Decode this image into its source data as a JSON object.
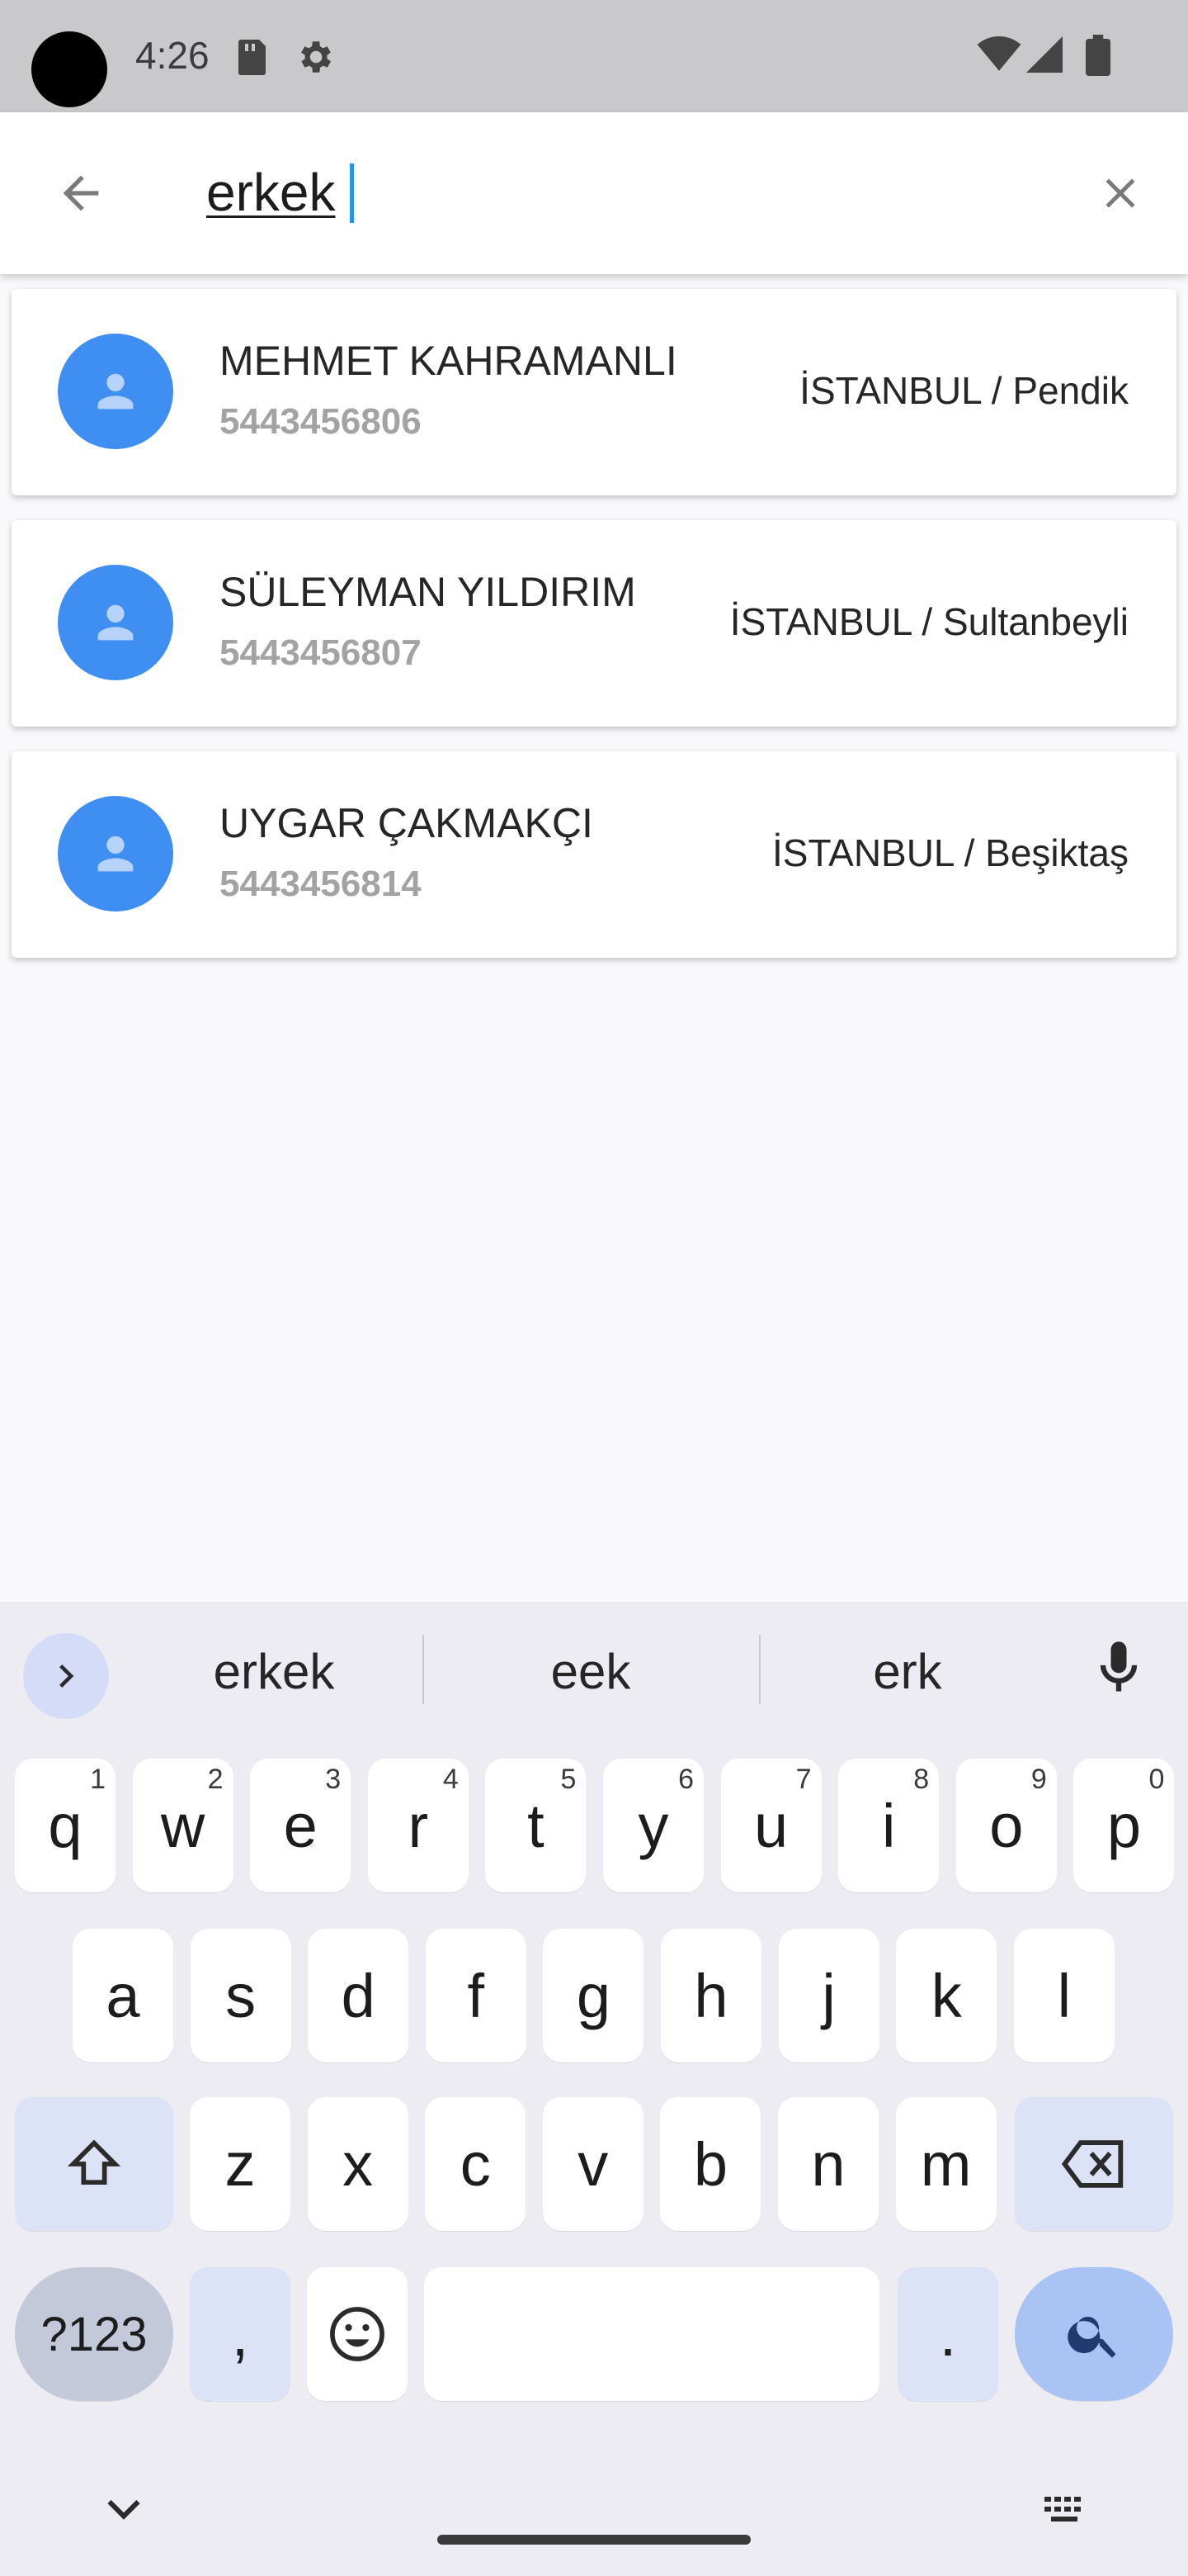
{
  "status_bar": {
    "time": "4:26"
  },
  "search": {
    "value": "erkek",
    "placeholder": ""
  },
  "results": [
    {
      "name": "MEHMET KAHRAMANLI",
      "phone": "5443456806",
      "location": "İSTANBUL / Pendik"
    },
    {
      "name": "SÜLEYMAN YILDIRIM",
      "phone": "5443456807",
      "location": "İSTANBUL / Sultanbeyli"
    },
    {
      "name": "UYGAR ÇAKMAKÇI",
      "phone": "5443456814",
      "location": "İSTANBUL / Beşiktaş"
    }
  ],
  "keyboard": {
    "suggestions": [
      "erkek",
      "eek",
      "erk"
    ],
    "row1": [
      {
        "l": "q",
        "n": "1"
      },
      {
        "l": "w",
        "n": "2"
      },
      {
        "l": "e",
        "n": "3"
      },
      {
        "l": "r",
        "n": "4"
      },
      {
        "l": "t",
        "n": "5"
      },
      {
        "l": "y",
        "n": "6"
      },
      {
        "l": "u",
        "n": "7"
      },
      {
        "l": "i",
        "n": "8"
      },
      {
        "l": "o",
        "n": "9"
      },
      {
        "l": "p",
        "n": "0"
      }
    ],
    "row2": [
      "a",
      "s",
      "d",
      "f",
      "g",
      "h",
      "j",
      "k",
      "l"
    ],
    "row3": [
      "z",
      "x",
      "c",
      "v",
      "b",
      "n",
      "m"
    ],
    "symbols_label": "?123",
    "comma_label": ",",
    "period_label": "."
  },
  "colors": {
    "accent": "#2196f3",
    "avatar": "#3f8ff3",
    "keyboard_bg": "#eeecf3"
  },
  "icons": [
    "sd-card-icon",
    "settings-gear-icon",
    "wifi-icon",
    "cell-signal-icon",
    "battery-icon",
    "back-arrow-icon",
    "close-icon",
    "person-icon",
    "chevron-right-icon",
    "microphone-icon",
    "shift-icon",
    "backspace-icon",
    "emoji-icon",
    "search-icon",
    "chevron-down-icon",
    "keyboard-icon"
  ]
}
